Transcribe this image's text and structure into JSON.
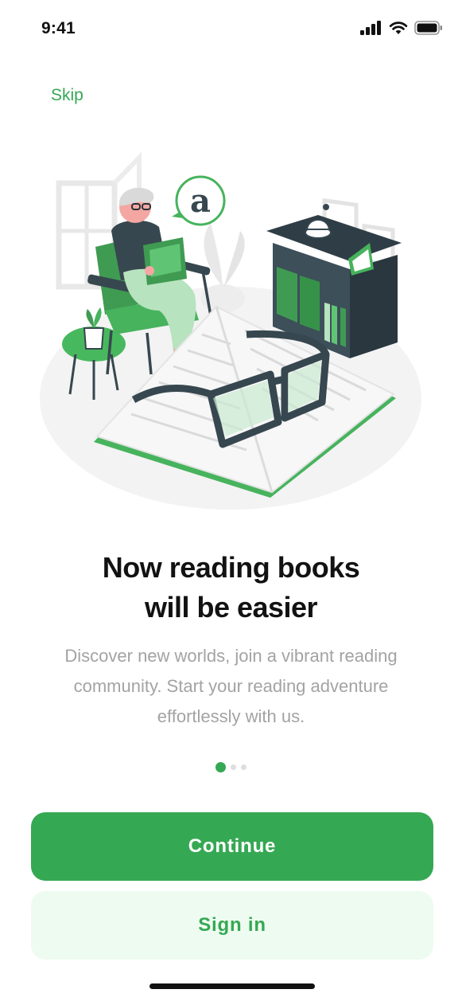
{
  "status_bar": {
    "time": "9:41",
    "icons": [
      "signal-icon",
      "wifi-icon",
      "battery-icon"
    ]
  },
  "onboarding": {
    "skip_label": "Skip",
    "headline_line1": "Now reading books",
    "headline_line2": "will be easier",
    "description": "Discover new worlds, join a vibrant reading community. Start your reading adventure effortlessly with us.",
    "illustration_badge": "a",
    "pager": {
      "total": 3,
      "active": 1
    }
  },
  "actions": {
    "primary_label": "Continue",
    "secondary_label": "Sign in"
  },
  "colors": {
    "accent": "#35a853",
    "secondary_bg": "#eefbf0",
    "text_muted": "#a3a3a3",
    "headline": "#121212"
  }
}
